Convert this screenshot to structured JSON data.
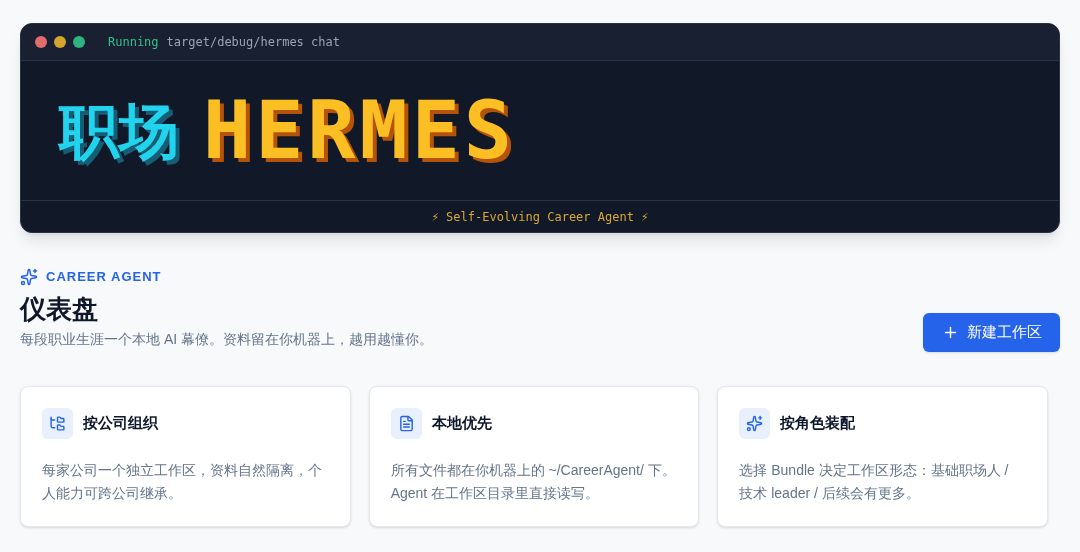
{
  "terminal": {
    "status": "Running",
    "command": "target/debug/hermes chat",
    "logo_cn": "职场",
    "logo_en": "HERMES",
    "tagline": "⚡ Self-Evolving Career Agent ⚡"
  },
  "header": {
    "eyebrow": "CAREER AGENT",
    "title": "仪表盘",
    "subtitle": "每段职业生涯一个本地 AI 幕僚。资料留在你机器上，越用越懂你。",
    "button": "新建工作区"
  },
  "cards": [
    {
      "kind": "tree",
      "title": "按公司组织",
      "text": "每家公司一个独立工作区，资料自然隔离，个人能力可跨公司继承。"
    },
    {
      "kind": "file",
      "title": "本地优先",
      "text": "所有文件都在你机器上的 ~/CareerAgent/ 下。Agent 在工作区目录里直接读写。"
    },
    {
      "kind": "sparkle",
      "title": "按角色装配",
      "text": "选择 Bundle 决定工作区形态：基础职场人 / 技术 leader / 后续会有更多。"
    }
  ]
}
